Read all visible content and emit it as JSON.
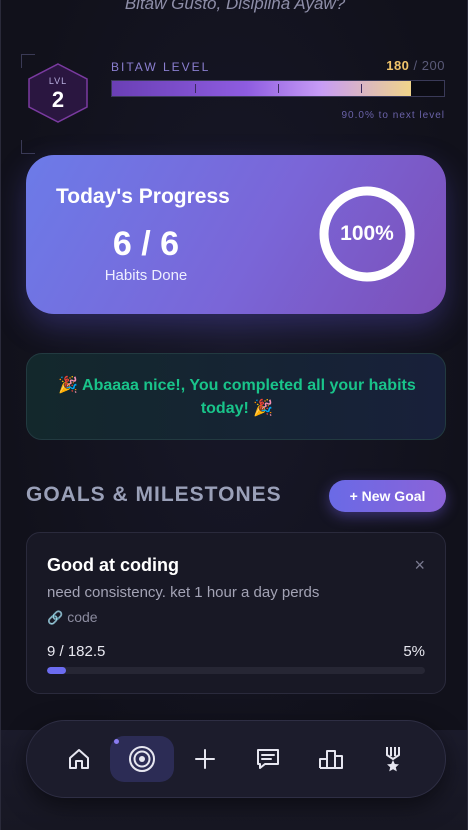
{
  "tagline": "Bitaw Gusto, Disiplina Ayaw?",
  "level": {
    "badge_label": "LVL",
    "number": "2",
    "title": "BITAW LEVEL",
    "xp_current": "180",
    "xp_separator": "/",
    "xp_max": "200",
    "fill_fraction": 0.9,
    "next_text": "90.0% to next level"
  },
  "progress": {
    "title": "Today's Progress",
    "count": "6 / 6",
    "subtitle": "Habits Done",
    "percent_text": "100%",
    "percent_value": 100
  },
  "congrats": {
    "text": "🎉 Abaaaa nice!, You completed all your habits today! 🎉"
  },
  "goals": {
    "title": "GOALS & MILESTONES",
    "new_button": "+ New Goal",
    "items": [
      {
        "title": "Good at coding",
        "close": "×",
        "description": "need consistency. ket 1 hour a day perds",
        "tag": "code",
        "value": "9 / 182.5",
        "percent": "5%",
        "fill_fraction": 0.05
      }
    ]
  },
  "nav": {
    "items": [
      "home-icon",
      "target-icon",
      "plus-icon",
      "chat-icon",
      "leaderboard-icon",
      "medal-icon"
    ],
    "active": "target-icon"
  },
  "colors": {
    "accent": "#6c6cf0",
    "success": "#19c48a",
    "xp_gold": "#f0c46a"
  }
}
